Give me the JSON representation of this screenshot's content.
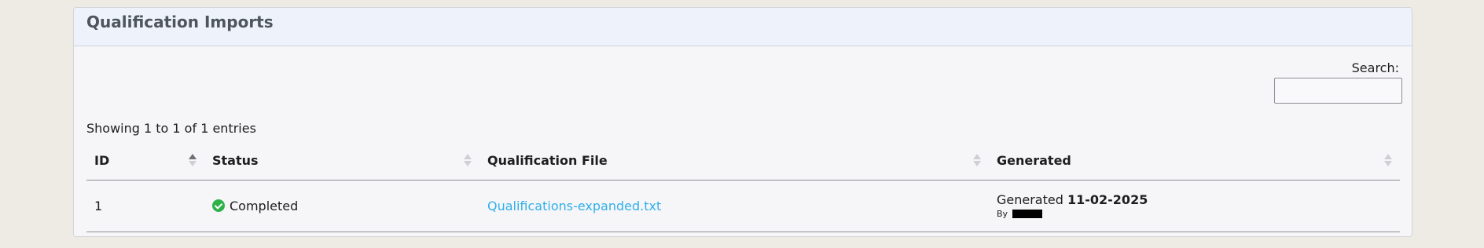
{
  "panel": {
    "title": "Qualification Imports"
  },
  "search": {
    "label": "Search:",
    "placeholder": "",
    "value": ""
  },
  "table_info": "Showing 1 to 1 of 1 entries",
  "table": {
    "columns": [
      "ID",
      "Status",
      "Qualification File",
      "Generated"
    ],
    "sort": {
      "column": "ID",
      "direction": "ascending"
    },
    "rows": [
      {
        "id": "1",
        "status": "Completed",
        "status_icon": "check-circle-icon",
        "status_color": "#2db24a",
        "file": "Qualifications-expanded.txt",
        "generated_prefix": "Generated",
        "generated_date": "11-02-2025",
        "by_label": "By"
      }
    ]
  },
  "colors": {
    "link": "#2fb0ea",
    "header_bg": "#eef2fa",
    "page_bg": "#eeebe4"
  }
}
